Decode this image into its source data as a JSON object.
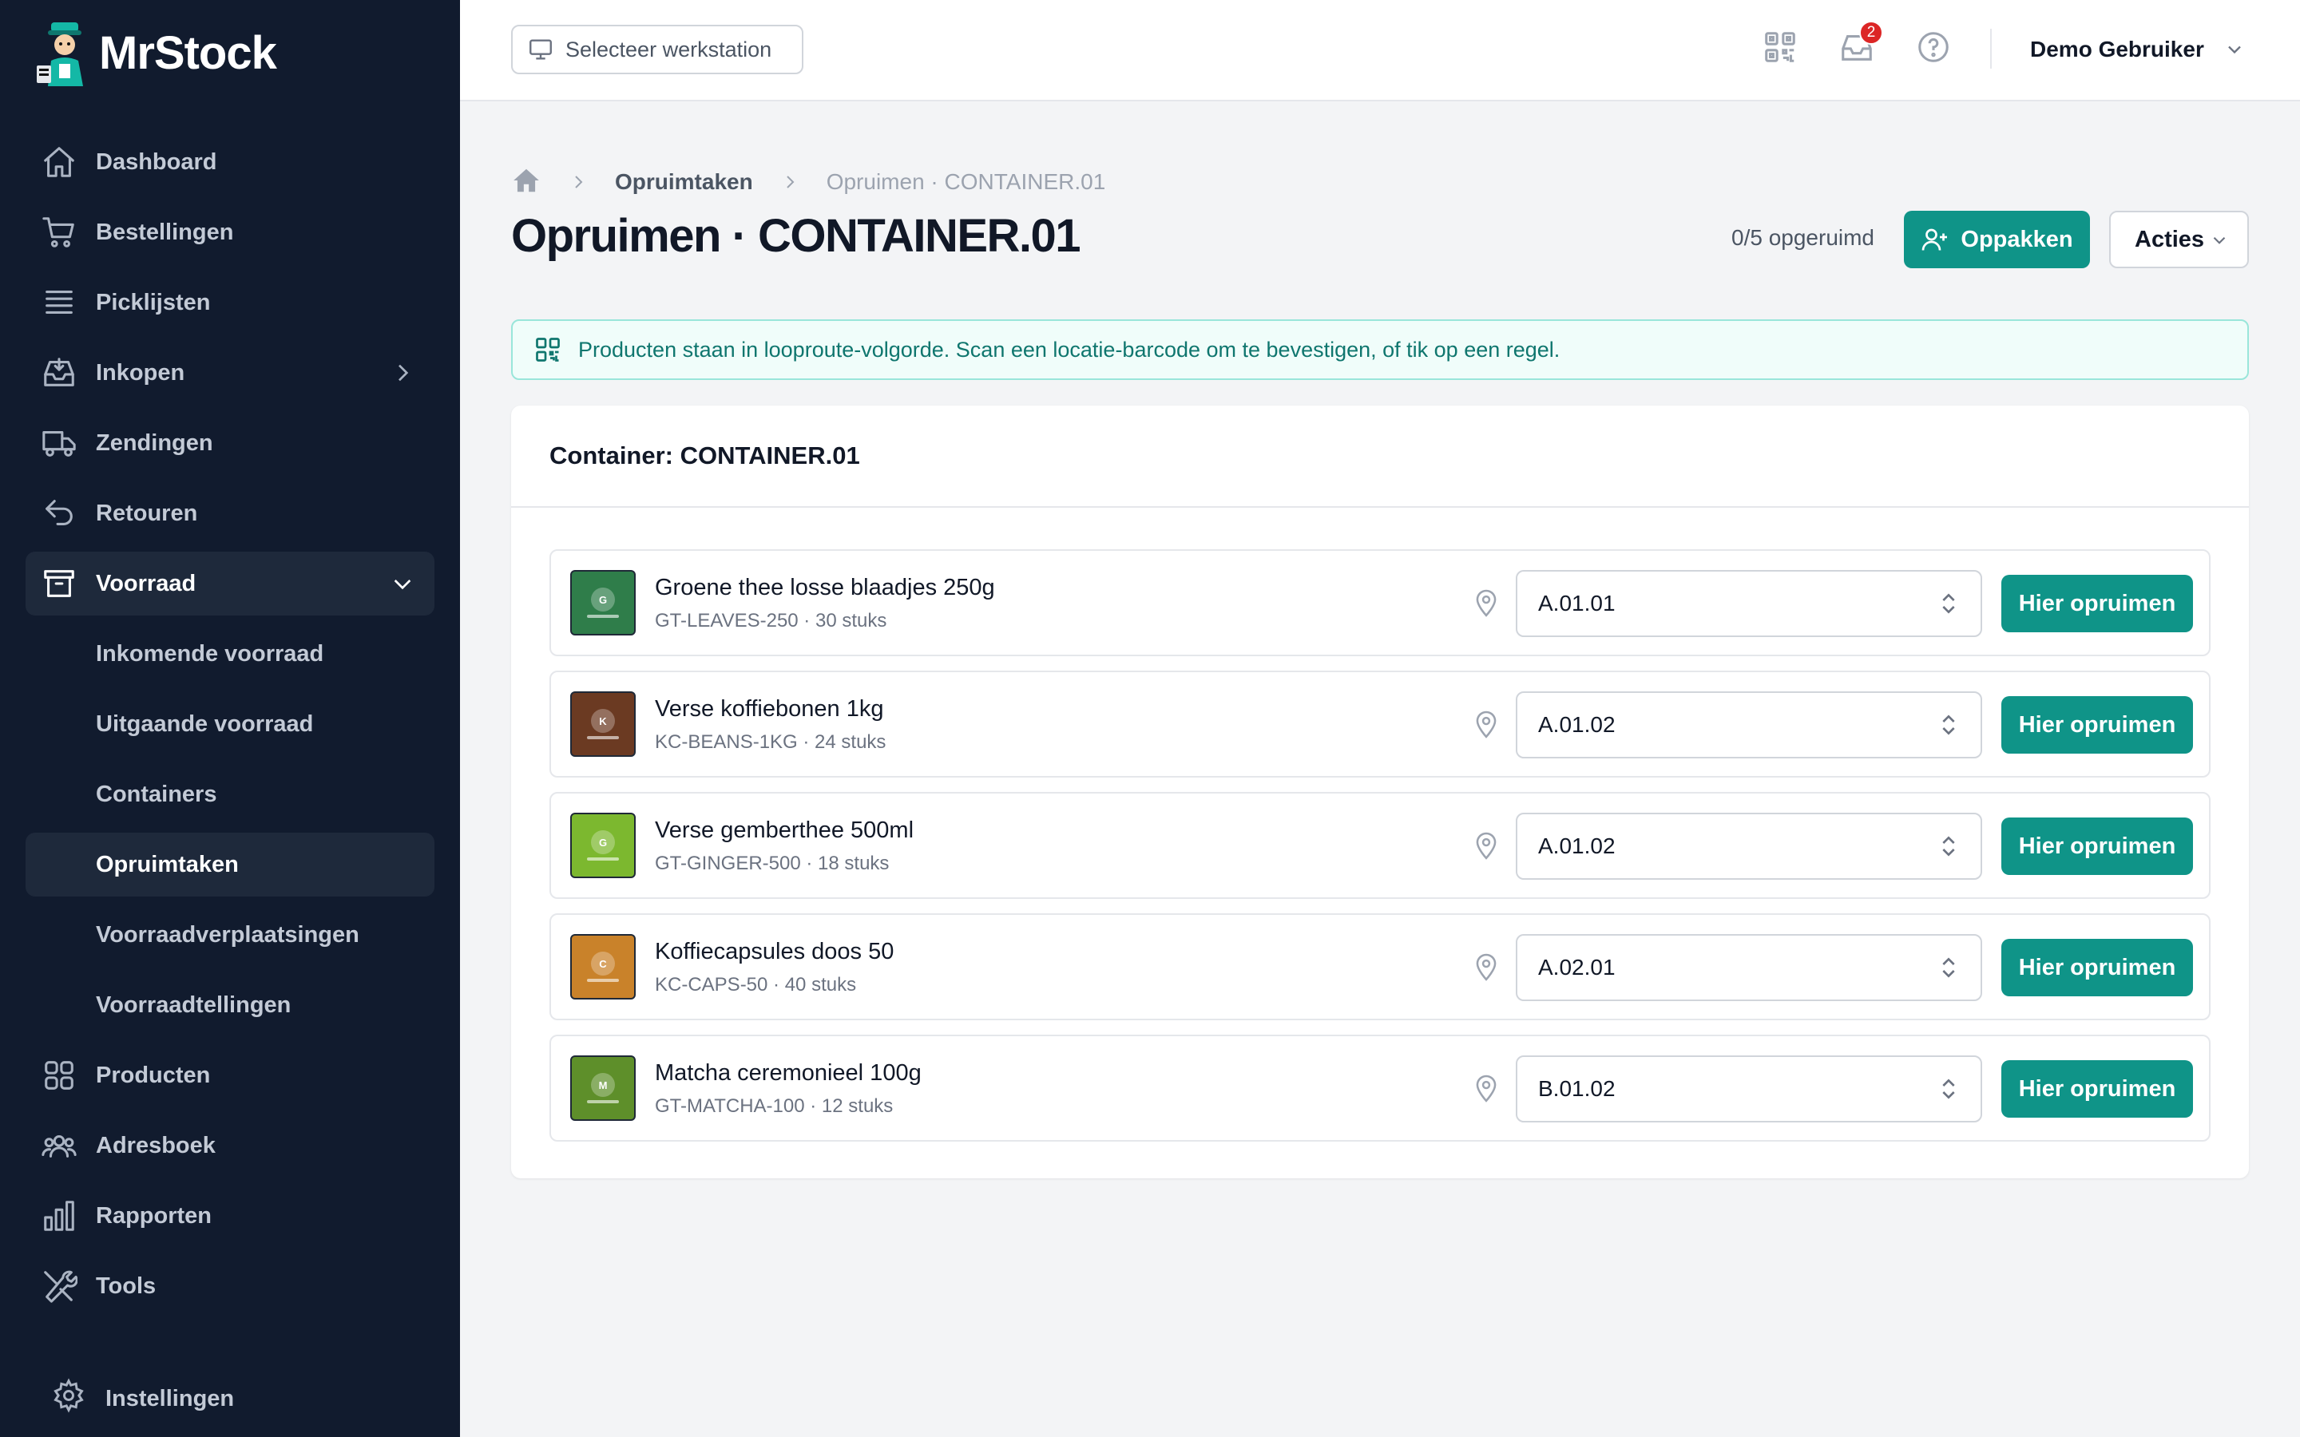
{
  "app": {
    "name": "MrStock"
  },
  "sidebar": {
    "items": [
      {
        "label": "Dashboard",
        "icon": "home-icon"
      },
      {
        "label": "Bestellingen",
        "icon": "cart-icon"
      },
      {
        "label": "Picklijsten",
        "icon": "list-icon"
      },
      {
        "label": "Inkopen",
        "icon": "inbox-icon"
      },
      {
        "label": "Zendingen",
        "icon": "truck-icon"
      },
      {
        "label": "Retouren",
        "icon": "return-icon"
      },
      {
        "label": "Voorraad",
        "icon": "archive-icon"
      },
      {
        "label": "Producten",
        "icon": "grid-icon"
      },
      {
        "label": "Adresboek",
        "icon": "users-icon"
      },
      {
        "label": "Rapporten",
        "icon": "bar-chart-icon"
      },
      {
        "label": "Tools",
        "icon": "tools-icon"
      }
    ],
    "voorraad_sub": [
      "Inkomende voorraad",
      "Uitgaande voorraad",
      "Containers",
      "Opruimtaken",
      "Voorraadverplaatsingen",
      "Voorraadtellingen"
    ],
    "active_item": "Voorraad",
    "active_sub": "Opruimtaken",
    "settings_label": "Instellingen"
  },
  "topbar": {
    "workstation_label": "Selecteer werkstation",
    "notification_count": "2",
    "user_name": "Demo Gebruiker"
  },
  "breadcrumb": {
    "items": [
      "Opruimtaken",
      "Opruimen · CONTAINER.01"
    ]
  },
  "page": {
    "title": "Opruimen · CONTAINER.01",
    "progress": "0/5 opgeruimd",
    "primary_button": "Oppakken",
    "actions_button": "Acties"
  },
  "info": {
    "text": "Producten staan in looproute-volgorde. Scan een locatie-barcode om te bevestigen, of tik op een regel."
  },
  "container": {
    "title": "Container: CONTAINER.01",
    "button_label": "Hier opruimen",
    "items": [
      {
        "name": "Groene thee losse blaadjes 250g",
        "meta": "GT-LEAVES-250 · 30 stuks",
        "location": "A.01.01",
        "thumb_letter": "G",
        "thumb_color": "#2f7d4a"
      },
      {
        "name": "Verse koffiebonen 1kg",
        "meta": "KC-BEANS-1KG · 24 stuks",
        "location": "A.01.02",
        "thumb_letter": "K",
        "thumb_color": "#6b3a22"
      },
      {
        "name": "Verse gemberthee 500ml",
        "meta": "GT-GINGER-500 · 18 stuks",
        "location": "A.01.02",
        "thumb_letter": "G",
        "thumb_color": "#7cb82f"
      },
      {
        "name": "Koffiecapsules doos 50",
        "meta": "KC-CAPS-50 · 40 stuks",
        "location": "A.02.01",
        "thumb_letter": "C",
        "thumb_color": "#c9822a"
      },
      {
        "name": "Matcha ceremonieel 100g",
        "meta": "GT-MATCHA-100 · 12 stuks",
        "location": "B.01.02",
        "thumb_letter": "M",
        "thumb_color": "#5e8f2a"
      }
    ]
  }
}
